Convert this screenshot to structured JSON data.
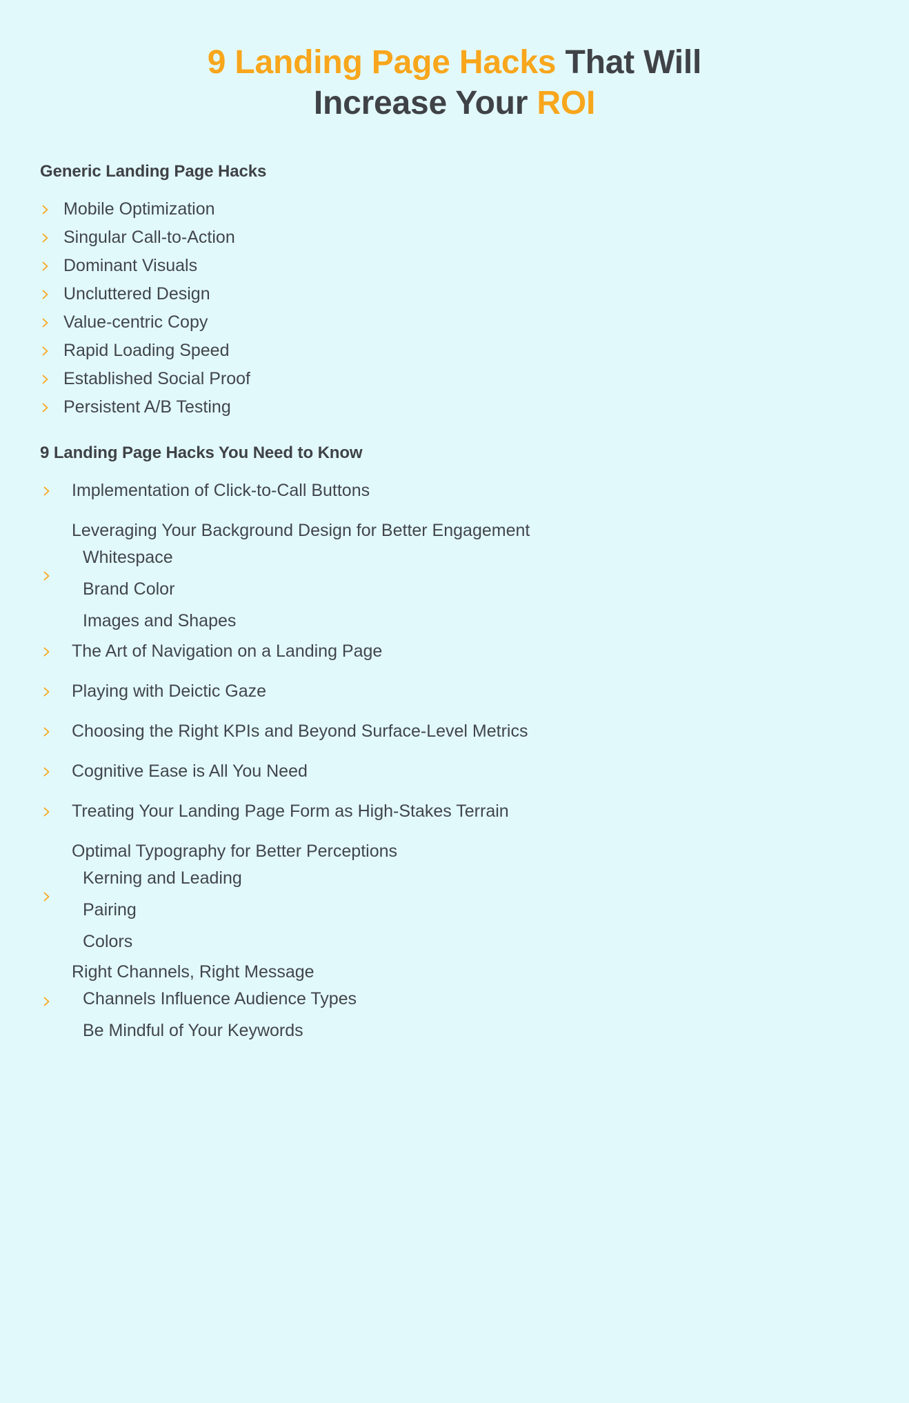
{
  "title": {
    "line1_accent": "9 Landing Page Hacks",
    "line1_rest": " That Will",
    "line2_rest": "Increase Your ",
    "line2_accent": "ROI"
  },
  "colors": {
    "background": "#e2f9fb",
    "accent": "#f8a61c",
    "text": "#41464b",
    "heading": "#3f4246"
  },
  "icons": {
    "bullet": "chevron-right-icon"
  },
  "sections": [
    {
      "heading": "Generic Landing Page Hacks",
      "items": [
        {
          "label": "Mobile Optimization",
          "sub": []
        },
        {
          "label": "Singular Call-to-Action",
          "sub": []
        },
        {
          "label": "Dominant Visuals",
          "sub": []
        },
        {
          "label": "Uncluttered Design",
          "sub": []
        },
        {
          "label": "Value-centric Copy",
          "sub": []
        },
        {
          "label": "Rapid Loading Speed",
          "sub": []
        },
        {
          "label": "Established Social Proof",
          "sub": []
        },
        {
          "label": "Persistent A/B Testing",
          "sub": []
        }
      ]
    },
    {
      "heading": "9 Landing Page Hacks You Need to Know",
      "items": [
        {
          "label": "Implementation of Click-to-Call Buttons",
          "sub": []
        },
        {
          "label": "Leveraging Your Background Design for Better Engagement",
          "sub": [
            "Whitespace",
            "Brand Color",
            "Images and Shapes"
          ]
        },
        {
          "label": "The Art of Navigation on a Landing Page",
          "sub": []
        },
        {
          "label": "Playing with Deictic Gaze",
          "sub": []
        },
        {
          "label": "Choosing the Right KPIs and Beyond Surface-Level Metrics",
          "sub": []
        },
        {
          "label": "Cognitive Ease is All You Need",
          "sub": []
        },
        {
          "label": "Treating Your Landing Page Form as High-Stakes Terrain",
          "sub": []
        },
        {
          "label": "Optimal Typography for Better Perceptions",
          "sub": [
            "Kerning and Leading",
            "Pairing",
            "Colors"
          ]
        },
        {
          "label": "Right Channels, Right Message",
          "sub": [
            "Channels Influence Audience Types",
            "Be Mindful of Your Keywords"
          ]
        }
      ]
    }
  ]
}
